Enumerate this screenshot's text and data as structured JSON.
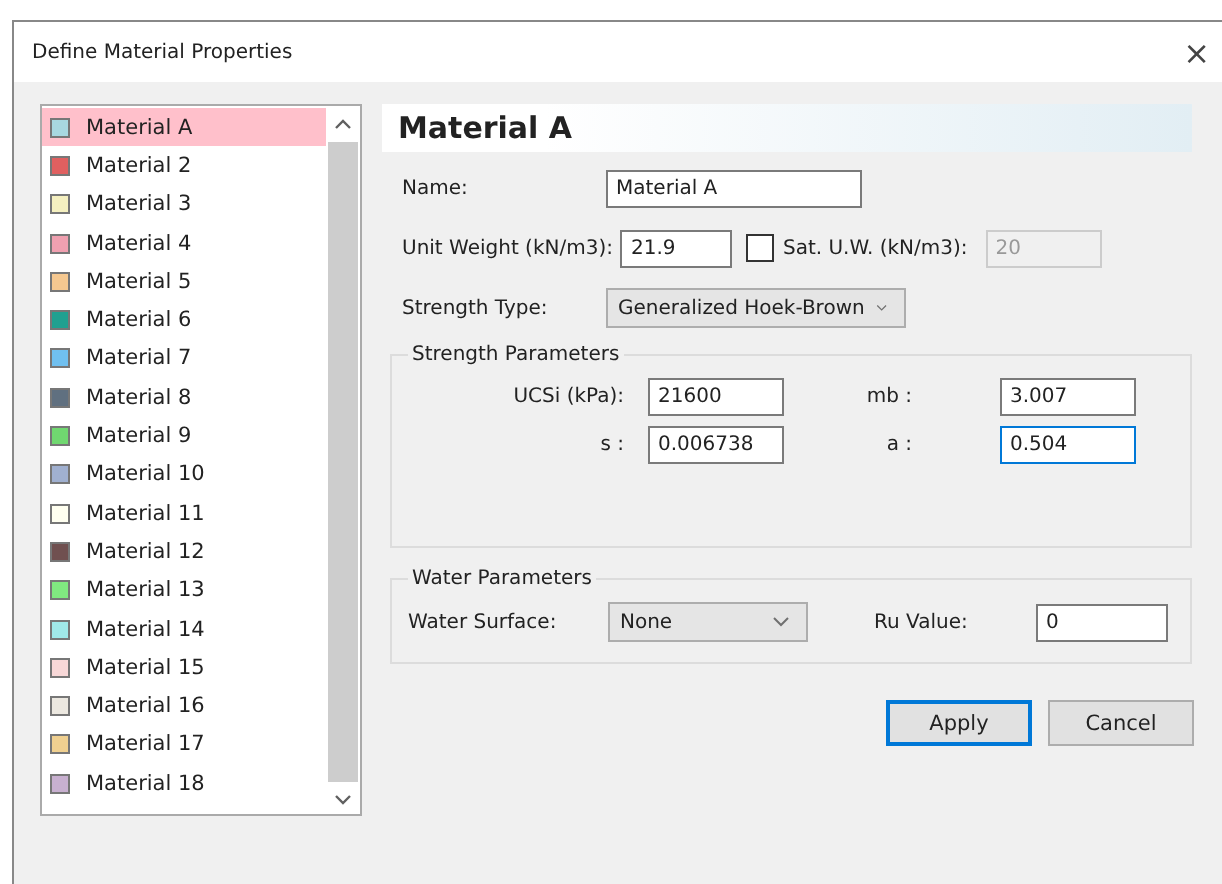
{
  "window": {
    "title": "Define Material Properties",
    "close": "×"
  },
  "materials": [
    {
      "name": "Material A",
      "color": "#a8d8e0",
      "selected": true
    },
    {
      "name": "Material 2",
      "color": "#e06060",
      "selected": false
    },
    {
      "name": "Material 3",
      "color": "#f5f0c0",
      "selected": false
    },
    {
      "name": "Material 4",
      "color": "#f0a0b0",
      "selected": false
    },
    {
      "name": "Material 5",
      "color": "#f5c890",
      "selected": false
    },
    {
      "name": "Material 6",
      "color": "#20a090",
      "selected": false
    },
    {
      "name": "Material 7",
      "color": "#70c0f0",
      "selected": false
    },
    {
      "name": "Material 8",
      "color": "#607080",
      "selected": false
    },
    {
      "name": "Material 9",
      "color": "#70d870",
      "selected": false
    },
    {
      "name": "Material 10",
      "color": "#a0b0d0",
      "selected": false
    },
    {
      "name": "Material 11",
      "color": "#fffff0",
      "selected": false
    },
    {
      "name": "Material 12",
      "color": "#705050",
      "selected": false
    },
    {
      "name": "Material 13",
      "color": "#80e880",
      "selected": false
    },
    {
      "name": "Material 14",
      "color": "#a0e8e8",
      "selected": false
    },
    {
      "name": "Material 15",
      "color": "#f8d8d8",
      "selected": false
    },
    {
      "name": "Material 16",
      "color": "#ece8e0",
      "selected": false
    },
    {
      "name": "Material 17",
      "color": "#f0d090",
      "selected": false
    },
    {
      "name": "Material 18",
      "color": "#c8b0d0",
      "selected": false
    }
  ],
  "heading": "Material A",
  "name": {
    "label": "Name:",
    "value": "Material A"
  },
  "unit_weight": {
    "label": "Unit Weight (kN/m3):",
    "value": "21.9"
  },
  "sat_uw": {
    "label": "Sat. U.W. (kN/m3):",
    "checked": false,
    "value": "20",
    "disabled": true
  },
  "strength_type": {
    "label": "Strength Type:",
    "value": "Generalized Hoek-Brown"
  },
  "strength_parameters": {
    "title": "Strength Parameters",
    "fields": [
      {
        "label": "UCSi (kPa):",
        "value": "21600",
        "focused": false
      },
      {
        "label": "mb :",
        "value": "3.007",
        "focused": false
      },
      {
        "label": "s :",
        "value": "0.006738",
        "focused": false
      },
      {
        "label": "a :",
        "value": "0.504",
        "focused": true
      }
    ]
  },
  "water_parameters": {
    "title": "Water Parameters",
    "surface_label": "Water Surface:",
    "surface_value": "None",
    "ru_label": "Ru Value:",
    "ru_value": "0"
  },
  "buttons": [
    {
      "label": "Apply",
      "default": true
    },
    {
      "label": "Cancel",
      "default": false
    }
  ]
}
